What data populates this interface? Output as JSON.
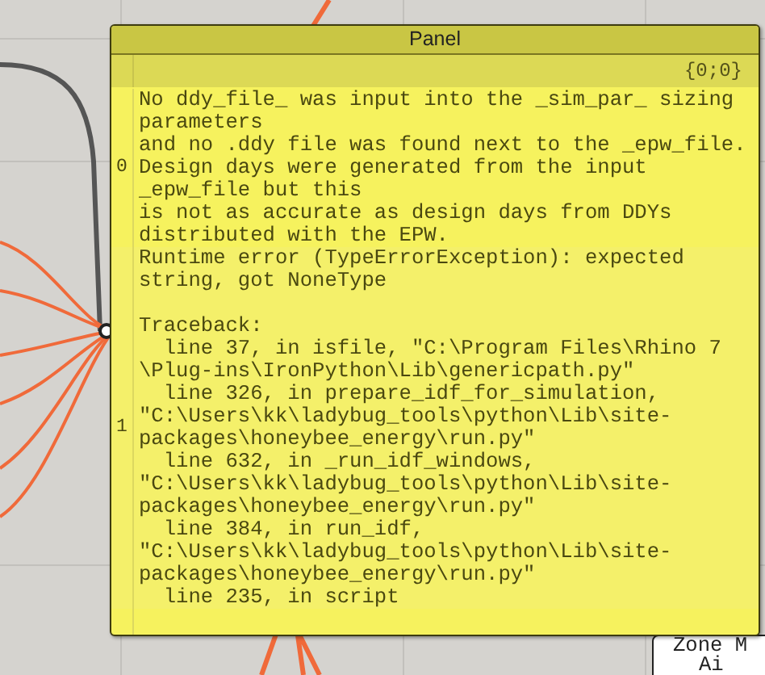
{
  "panel": {
    "title": "Panel",
    "path": "{0;0}",
    "items": [
      {
        "index": "0",
        "paragraphs": [
          [
            "No ddy_file_ was input into the _sim_par_ sizing",
            "parameters",
            "and no .ddy file was found next to the _epw_file.",
            "Design days were generated from the input",
            "_epw_file but this",
            "is not as accurate as design days from DDYs",
            "distributed with the EPW."
          ]
        ]
      },
      {
        "index": "1",
        "paragraphs": [
          [
            "Runtime error (TypeErrorException): expected",
            "string, got NoneType"
          ],
          [
            "Traceback:",
            "  line 37, in isfile, \"C:\\Program Files\\Rhino 7",
            "\\Plug-ins\\IronPython\\Lib\\genericpath.py\"",
            "  line 326, in prepare_idf_for_simulation,",
            "\"C:\\Users\\kk\\ladybug_tools\\python\\Lib\\site-",
            "packages\\honeybee_energy\\run.py\"",
            "  line 632, in _run_idf_windows,",
            "\"C:\\Users\\kk\\ladybug_tools\\python\\Lib\\site-",
            "packages\\honeybee_energy\\run.py\"",
            "  line 384, in run_idf,",
            "\"C:\\Users\\kk\\ladybug_tools\\python\\Lib\\site-",
            "packages\\honeybee_energy\\run.py\"",
            "  line 235, in script"
          ]
        ]
      }
    ]
  },
  "component": {
    "lines": [
      "Zone M",
      "Ai"
    ]
  }
}
